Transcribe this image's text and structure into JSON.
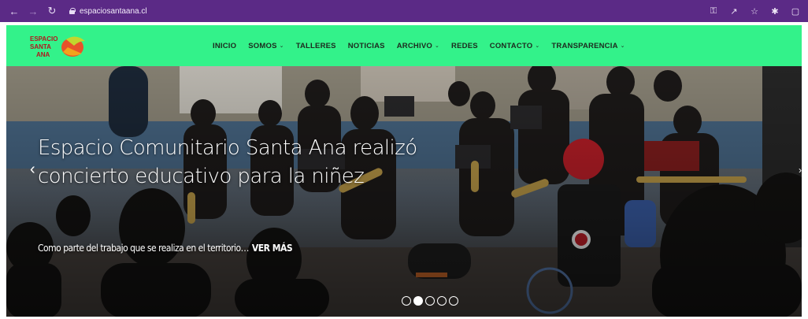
{
  "browser": {
    "url": "espaciosantaana.cl",
    "icons": {
      "back": "arrow-left-icon",
      "forward": "arrow-right-icon",
      "reload": "reload-icon",
      "lock": "lock-icon",
      "key": "key-icon",
      "share": "share-icon",
      "bookmark": "star-icon",
      "extensions": "puzzle-icon",
      "sidepanel": "sidepanel-icon"
    },
    "colors": {
      "bar": "#5b2a86"
    }
  },
  "site": {
    "logo_name": "espacio-santa-ana-logo",
    "header_color": "#33f28a",
    "menu": [
      {
        "label": "INICIO",
        "dropdown": false
      },
      {
        "label": "SOMOS",
        "dropdown": true
      },
      {
        "label": "TALLERES",
        "dropdown": false
      },
      {
        "label": "NOTICIAS",
        "dropdown": false
      },
      {
        "label": "ARCHIVO",
        "dropdown": true
      },
      {
        "label": "REDES",
        "dropdown": false
      },
      {
        "label": "CONTACTO",
        "dropdown": true
      },
      {
        "label": "TRANSPARENCIA",
        "dropdown": true
      }
    ]
  },
  "hero": {
    "title": "Espacio Comunitario Santa Ana realizó concierto educativo para la niñez",
    "excerpt": "Como parte del trabajo que se realiza en el territorio…",
    "read_more": "VER MÁS",
    "prev_arrow": "‹",
    "next_arrow": "›",
    "slides": 5,
    "active_slide": 2
  }
}
